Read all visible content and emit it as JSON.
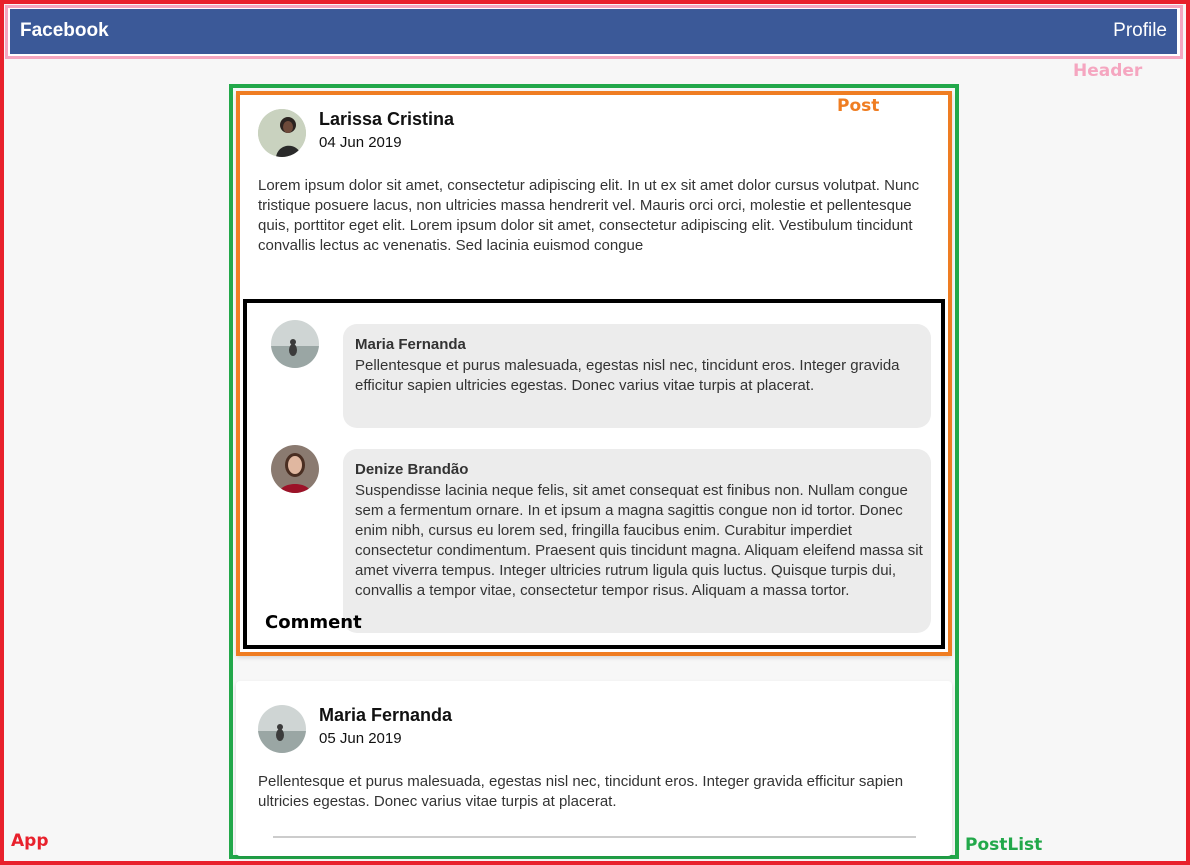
{
  "header": {
    "brand": "Facebook",
    "profile_label": "Profile"
  },
  "labels": {
    "header": "Header",
    "app": "App",
    "postlist": "PostList",
    "post": "Post",
    "comment": "Comment"
  },
  "posts": [
    {
      "author": "Larissa Cristina",
      "date": "04 Jun 2019",
      "content": "Lorem ipsum dolor sit amet, consectetur adipiscing elit. In ut ex sit amet dolor cursus volutpat. Nunc tristique posuere lacus, non ultricies massa hendrerit vel. Mauris orci orci, molestie et pellentesque quis, porttitor eget elit. Lorem ipsum dolor sit amet, consectetur adipiscing elit. Vestibulum tincidunt convallis lectus ac venenatis. Sed lacinia euismod congue",
      "comments": [
        {
          "author": "Maria Fernanda",
          "content": "Pellentesque et purus malesuada, egestas nisl nec, tincidunt eros. Integer gravida efficitur sapien ultricies egestas. Donec varius vitae turpis at placerat."
        },
        {
          "author": "Denize Brandão",
          "content": "Suspendisse lacinia neque felis, sit amet consequat est finibus non. Nullam congue sem a fermentum ornare. In et ipsum a magna sagittis congue non id tortor. Donec enim nibh, cursus eu lorem sed, fringilla faucibus enim. Curabitur imperdiet consectetur condimentum. Praesent quis tincidunt magna. Aliquam eleifend massa sit amet viverra tempus. Integer ultricies rutrum ligula quis luctus. Quisque turpis dui, convallis a tempor vitae, consectetur tempor risus. Aliquam a massa tortor."
        }
      ]
    },
    {
      "author": "Maria Fernanda",
      "date": "05 Jun 2019",
      "content": "Pellentesque et purus malesuada, egestas nisl nec, tincidunt eros. Integer gravida efficitur sapien ultricies egestas. Donec varius vitae turpis at placerat."
    }
  ],
  "colors": {
    "header_bg": "#3b5998",
    "app_outline": "#e8212c",
    "header_outline": "#f5a6c0",
    "postlist_outline": "#22a84a",
    "post_outline": "#ef7d22",
    "comment_outline": "#000000",
    "comment_bubble": "#ececec"
  }
}
